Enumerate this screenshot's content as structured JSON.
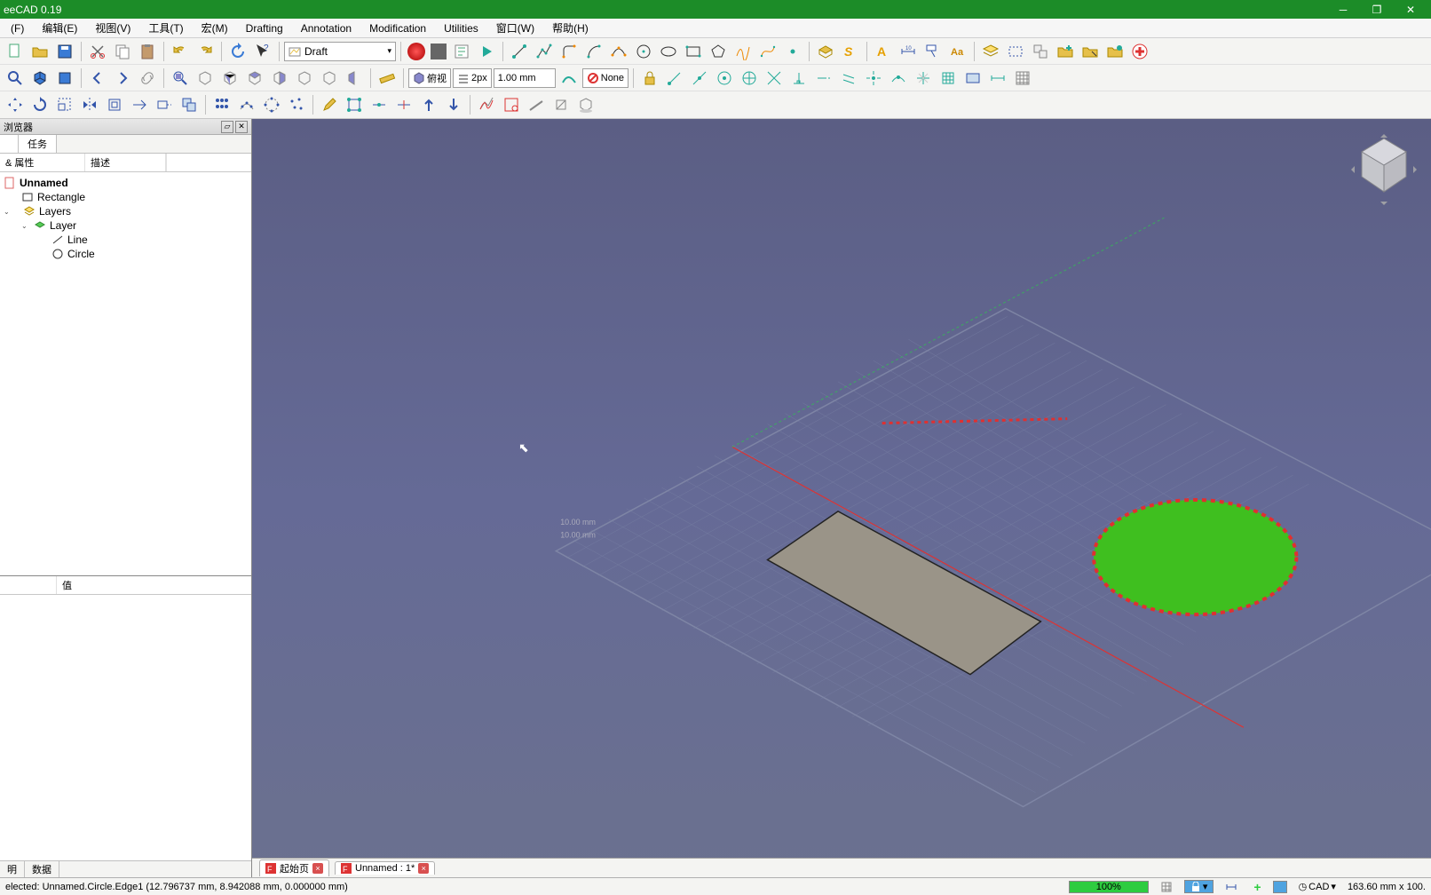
{
  "title": "eeCAD 0.19",
  "menus": [
    "(F)",
    "编辑(E)",
    "视图(V)",
    "工具(T)",
    "宏(M)",
    "Drafting",
    "Annotation",
    "Modification",
    "Utilities",
    "窗口(W)",
    "帮助(H)"
  ],
  "workbench": "Draft",
  "tb_view_label": "俯视",
  "tb_px": "2px",
  "tb_mm": "1.00 mm",
  "tb_none": "None",
  "sidebar_panel_title": "浏览器",
  "sidebar_tabs": [
    "任务"
  ],
  "tree_cols": [
    "& 属性",
    "描述"
  ],
  "tree": {
    "doc": "Unnamed",
    "items": [
      {
        "label": "Rectangle",
        "icon": "rect"
      },
      {
        "label": "Layers",
        "icon": "layers",
        "children": [
          {
            "label": "Layer",
            "icon": "layer",
            "children": [
              {
                "label": "Line",
                "icon": "line"
              },
              {
                "label": "Circle",
                "icon": "circle"
              }
            ]
          }
        ]
      }
    ]
  },
  "prop_col": "值",
  "bottom_tabs": [
    "明",
    "数据"
  ],
  "doctabs": [
    {
      "label": "起始页",
      "close": true
    },
    {
      "label": "Unnamed : 1*",
      "close": true
    }
  ],
  "status_preselect": "elected: Unnamed.Circle.Edge1 (12.796737 mm, 8.942088 mm, 0.000000 mm)",
  "status_zoom": "100%",
  "status_cad": "CAD",
  "status_coords": "163.60 mm x 100.",
  "axis_labels": {
    "x": "10.00 mm",
    "y": "10.00 mm"
  }
}
